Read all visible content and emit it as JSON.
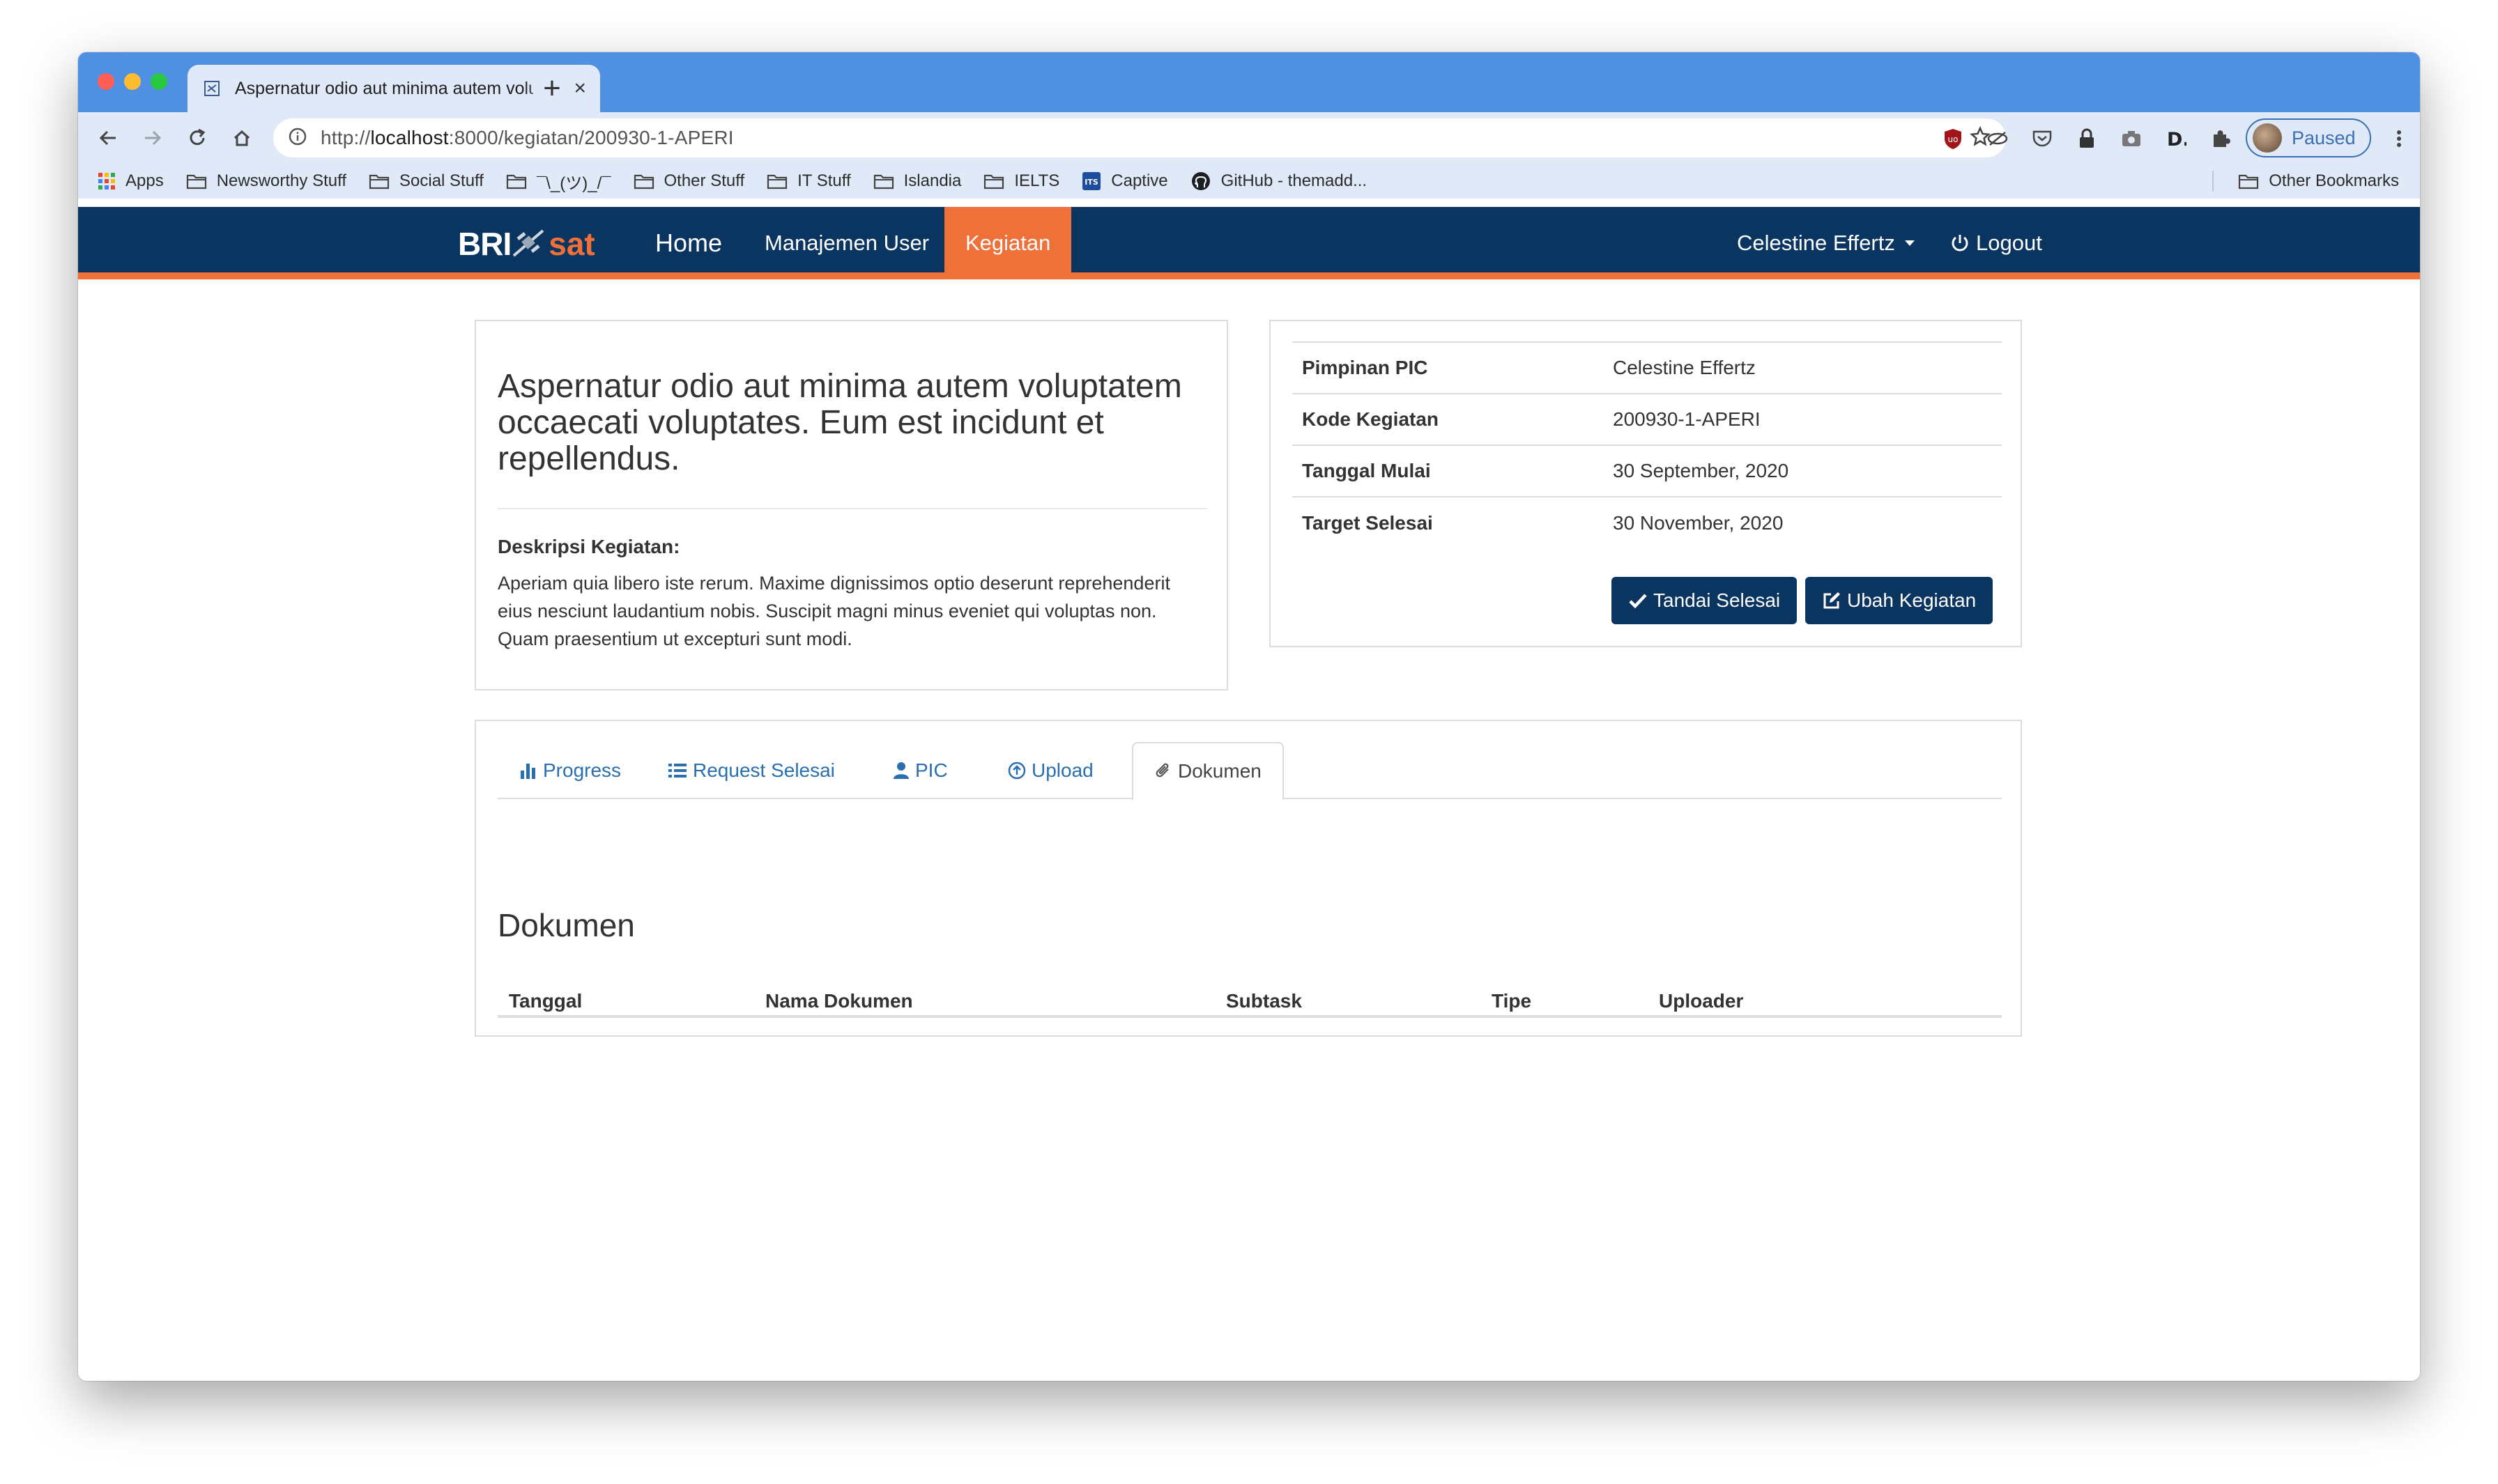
{
  "browser": {
    "tab_title": "Aspernatur odio aut minima autem voluptatem occaecati voluptates",
    "tab_close": "×",
    "new_tab": "+",
    "url_prefix": "http://",
    "url_host": "localhost",
    "url_path": ":8000/kegiatan/200930-1-APERI",
    "profile_status": "Paused",
    "bookmarks": [
      {
        "label": "Apps",
        "icon": "apps-grid-icon"
      },
      {
        "label": "Newsworthy Stuff",
        "icon": "folder-icon"
      },
      {
        "label": "Social Stuff",
        "icon": "folder-icon"
      },
      {
        "label": "¯\\_(ツ)_/¯",
        "icon": "folder-icon"
      },
      {
        "label": "Other Stuff",
        "icon": "folder-icon"
      },
      {
        "label": "IT Stuff",
        "icon": "folder-icon"
      },
      {
        "label": "Islandia",
        "icon": "folder-icon"
      },
      {
        "label": "IELTS",
        "icon": "folder-icon"
      },
      {
        "label": "Captive",
        "icon": "its-icon"
      },
      {
        "label": "GitHub - themadd...",
        "icon": "github-icon"
      }
    ],
    "other_bookmarks": "Other Bookmarks"
  },
  "site": {
    "logo_left": "BRI",
    "logo_right": "sat",
    "nav": {
      "home": "Home",
      "users": "Manajemen User",
      "activity": "Kegiatan"
    },
    "user_name": "Celestine Effertz",
    "logout": "Logout"
  },
  "activity": {
    "title": "Aspernatur odio aut minima autem voluptatem occaecati voluptates. Eum est incidunt et repellendus.",
    "description_label": "Deskripsi Kegiatan:",
    "description": "Aperiam quia libero iste rerum. Maxime dignissimos optio deserunt reprehenderit eius nesciunt laudantium nobis. Suscipit magni minus eveniet qui voluptas non. Quam praesentium ut excepturi sunt modi.",
    "info": [
      {
        "key": "Pimpinan PIC",
        "value": "Celestine Effertz"
      },
      {
        "key": "Kode Kegiatan",
        "value": "200930-1-APERI"
      },
      {
        "key": "Tanggal Mulai",
        "value": "30 September, 2020"
      },
      {
        "key": "Target Selesai",
        "value": "30 November, 2020"
      }
    ],
    "buttons": {
      "mark_done": "Tandai Selesai",
      "edit": "Ubah Kegiatan"
    }
  },
  "tabs": [
    {
      "label": "Progress",
      "icon": "bar-chart-icon"
    },
    {
      "label": "Request Selesai",
      "icon": "list-icon"
    },
    {
      "label": "PIC",
      "icon": "user-icon"
    },
    {
      "label": "Upload",
      "icon": "upload-circle-icon"
    },
    {
      "label": "Dokumen",
      "icon": "paperclip-icon",
      "active": true
    }
  ],
  "documents": {
    "title": "Dokumen",
    "columns": [
      "Tanggal",
      "Nama Dokumen",
      "Subtask",
      "Tipe",
      "Uploader"
    ]
  },
  "colors": {
    "navy": "#0b3561",
    "orange": "#f0703a",
    "chrome_blue": "#4f90e3"
  }
}
